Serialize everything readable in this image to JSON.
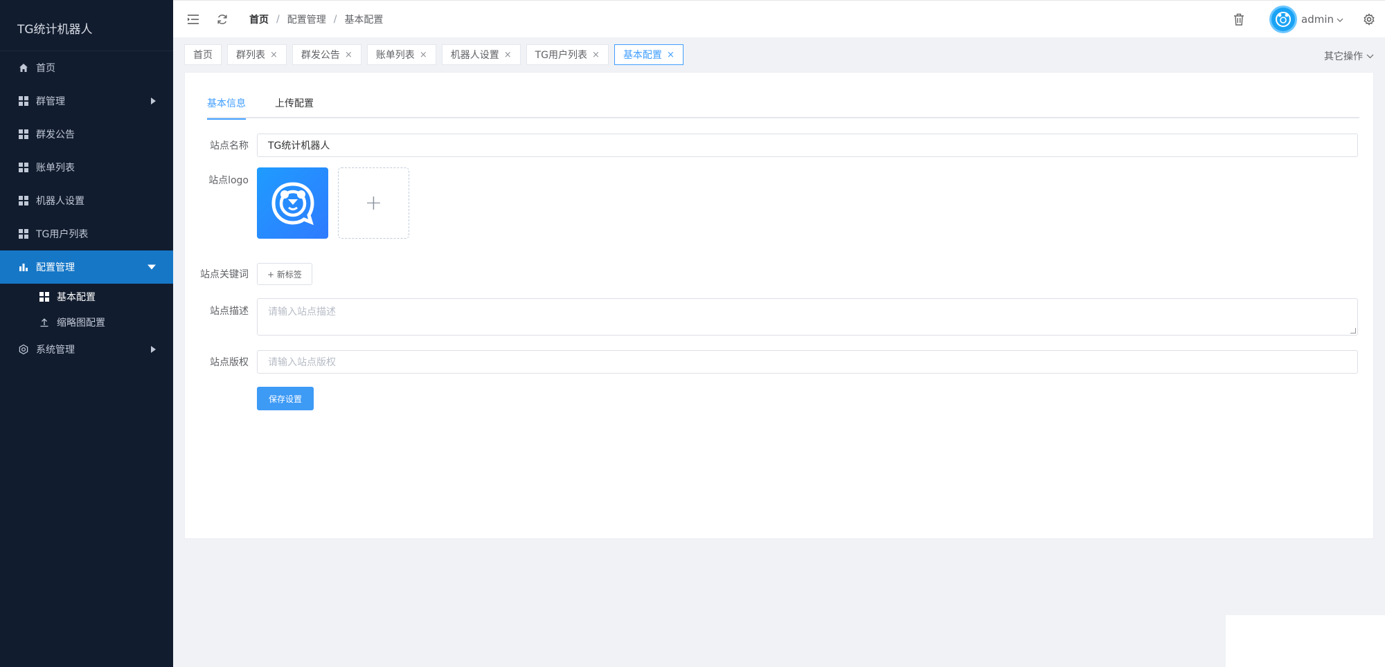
{
  "sidebar": {
    "brand": "TG统计机器人",
    "items": [
      {
        "label": "首页"
      },
      {
        "label": "群管理"
      },
      {
        "label": "群发公告"
      },
      {
        "label": "账单列表"
      },
      {
        "label": "机器人设置"
      },
      {
        "label": "TG用户列表"
      },
      {
        "label": "配置管理"
      },
      {
        "label": "系统管理"
      }
    ],
    "sub_items": [
      {
        "label": "基本配置"
      },
      {
        "label": "缩略图配置"
      }
    ]
  },
  "header": {
    "breadcrumb": [
      "首页",
      "配置管理",
      "基本配置"
    ],
    "separator": "/",
    "user_name": "admin"
  },
  "tabs": [
    {
      "label": "首页"
    },
    {
      "label": "群列表"
    },
    {
      "label": "群发公告"
    },
    {
      "label": "账单列表"
    },
    {
      "label": "机器人设置"
    },
    {
      "label": "TG用户列表"
    },
    {
      "label": "基本配置"
    }
  ],
  "tab_close": "×",
  "other_ops": "其它操作",
  "panel_tabs": [
    {
      "label": "基本信息"
    },
    {
      "label": "上传配置"
    }
  ],
  "form": {
    "site_name_label": "站点名称",
    "site_name_value": "TG统计机器人",
    "logo_label": "站点logo",
    "upload_plus": "+",
    "keywords_label": "站点关键词",
    "new_tag": "+ 新标签",
    "desc_label": "站点描述",
    "desc_placeholder": "请输入站点描述",
    "copyright_label": "站点版权",
    "copyright_placeholder": "请输入站点版权",
    "save_label": "保存设置"
  },
  "colors": {
    "sidebar_bg": "#111c2e",
    "active_bg": "#1677c7",
    "accent": "#409eff"
  }
}
